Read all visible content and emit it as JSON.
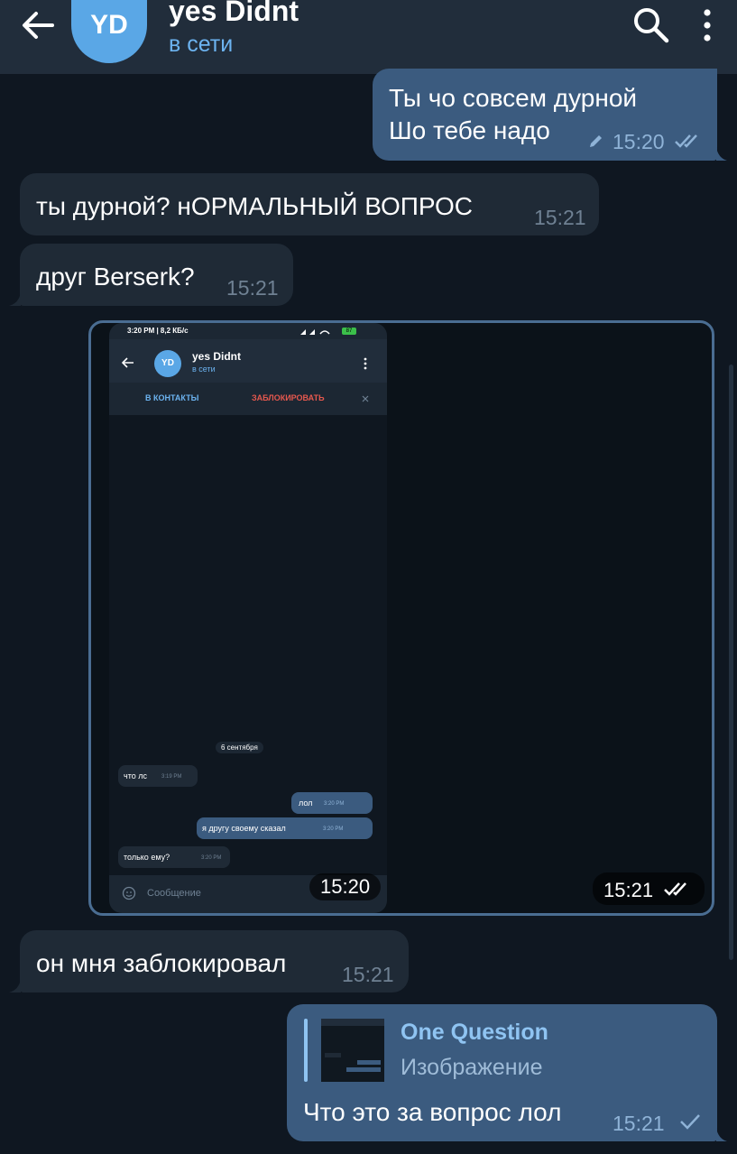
{
  "header": {
    "back_icon": "arrow-left-icon",
    "avatar_initials": "YD",
    "title": "yes Didnt",
    "status": "в сети",
    "search_icon": "search-icon",
    "more_icon": "more-vertical-icon"
  },
  "colors": {
    "background": "#0f1721",
    "header": "#212d3b",
    "incoming_bubble": "#1f2a36",
    "outgoing_bubble": "#3b5b7f",
    "accent": "#6cb3f0"
  },
  "messages": [
    {
      "direction": "out",
      "lines": [
        "Ты чо совсем дурной",
        "Шо тебе надо"
      ],
      "time": "15:20",
      "edited": true,
      "status": "read"
    },
    {
      "direction": "in",
      "text": "ты дурной? нОРМАЛЬНЫЙ ВОПРОС",
      "time": "15:21"
    },
    {
      "direction": "in",
      "text": "друг Berserk?",
      "time": "15:21"
    },
    {
      "direction": "out",
      "type": "photo",
      "time": "15:21",
      "status": "read",
      "screenshot": {
        "statusbar_time": "3:20 PM | 8,2 КБ/с",
        "battery": "87",
        "title": "yes Didnt",
        "status": "в сети",
        "avatar_initials": "YD",
        "add_contact": "В КОНТАКТЫ",
        "block": "ЗАБЛОКИРОВАТЬ",
        "date": "6 сентября",
        "messages": [
          {
            "direction": "in",
            "text": "что лс",
            "time": "3:19 PM"
          },
          {
            "direction": "out",
            "text": "лол",
            "time": "3:20 PM"
          },
          {
            "direction": "out",
            "text": "я другу своему сказал",
            "time": "3:20 PM"
          },
          {
            "direction": "in",
            "text": "только ему?",
            "time": "3:20 PM"
          }
        ],
        "input_placeholder": "Сообщение",
        "overlay_time": "15:20"
      }
    },
    {
      "direction": "in",
      "text": "он мня заблокировал",
      "time": "15:21"
    },
    {
      "direction": "out",
      "reply_to": {
        "name": "One Question",
        "type": "Изображение"
      },
      "text": "Что это за вопрос лол",
      "time": "15:21",
      "status": "sent"
    }
  ]
}
